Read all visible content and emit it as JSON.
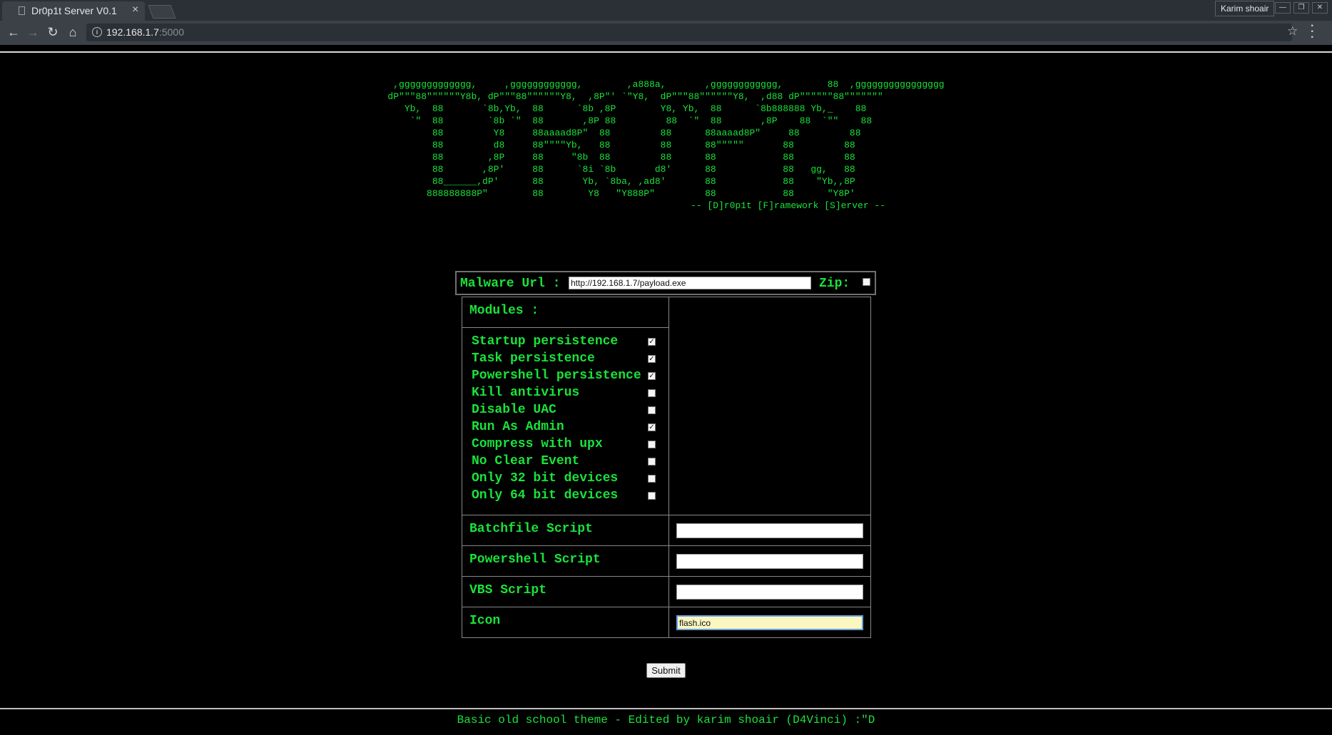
{
  "browser": {
    "tab_title": "Dr0p1t Server V0.1",
    "tab_close": "×",
    "user_name": "Karim shoair",
    "url_host": "192.168.1.7",
    "url_port": ":5000"
  },
  "banner": {
    "ascii_art": " ,ggggggggggggg,     ,gggggggggggg,        ,a888a,       ,gggggggggggg,        88  ,gggggggggggggggg\ndP\"\"\"88\"\"\"\"\"\"Y8b, dP\"\"\"88\"\"\"\"\"\"Y8,  ,8P\"' `\"Y8,  dP\"\"\"88\"\"\"\"\"\"Y8,  ,d88 dP\"\"\"\"\"\"88\"\"\"\"\"\"\"\n   Yb,  88       `8b,Yb,  88      `8b ,8P        Y8, Yb,  88      `8b888888 Yb,_    88\n    `\"  88        `8b `\"  88       ,8P 88         88  `\"  88       ,8P    88  `\"\"    88\n        88         Y8     88aaaad8P\"  88         88      88aaaad8P\"     88         88\n        88         d8     88\"\"\"\"Yb,   88         88      88\"\"\"\"\"       88         88\n        88        ,8P     88     \"8b  88         88      88            88         88\n        88       ,8P'     88      `8i `8b       d8'      88            88   gg,   88\n        88______,dP'      88       Yb, `8ba, ,ad8'       88            88    \"Yb,,8P\n       888888888P\"        88        Y8   \"Y888P\"         88            88      \"Y8P'",
    "subtitle": "-- [D]r0p1t [F]ramework [S]erver --"
  },
  "form": {
    "malware_url_label": "Malware Url :",
    "malware_url_value": "http://192.168.1.7/payload.exe",
    "zip_label": "Zip:",
    "zip_checked": false,
    "modules_label": "Modules :",
    "modules": [
      {
        "label": "Startup persistence",
        "checked": true
      },
      {
        "label": "Task persistence",
        "checked": true
      },
      {
        "label": "Powershell persistence",
        "checked": true
      },
      {
        "label": "Kill antivirus",
        "checked": false
      },
      {
        "label": "Disable UAC",
        "checked": false
      },
      {
        "label": "Run As Admin",
        "checked": true
      },
      {
        "label": "Compress with upx",
        "checked": false
      },
      {
        "label": "No Clear Event",
        "checked": false
      },
      {
        "label": "Only 32 bit devices",
        "checked": false
      },
      {
        "label": "Only 64 bit devices",
        "checked": false
      }
    ],
    "batch_label": "Batchfile Script",
    "batch_value": "",
    "powershell_label": "Powershell Script",
    "powershell_value": "",
    "vbs_label": "VBS Script",
    "vbs_value": "",
    "icon_label": "Icon",
    "icon_value": "flash.ico",
    "submit_label": "Submit"
  },
  "footer": {
    "text": "Basic old school theme - Edited by karim shoair (D4Vinci) :\"D"
  },
  "colors": {
    "accent_green": "#19e33a",
    "background": "#000000"
  }
}
